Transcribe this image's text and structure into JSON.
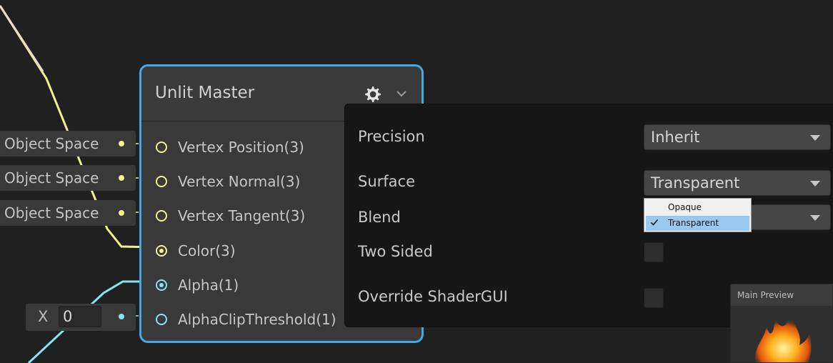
{
  "inputs": {
    "vertex_position_space": "Object Space",
    "vertex_normal_space": "Object Space",
    "vertex_tangent_space": "Object Space",
    "alpha_clip": {
      "axis_label": "X",
      "value": "0"
    }
  },
  "node": {
    "title": "Unlit Master",
    "gear_icon": "gear-icon",
    "collapse_icon": "chevron-down-icon",
    "ports": [
      {
        "label": "Vertex Position(3)",
        "color": "#f4f58e",
        "connected": false
      },
      {
        "label": "Vertex Normal(3)",
        "color": "#f4f58e",
        "connected": false
      },
      {
        "label": "Vertex Tangent(3)",
        "color": "#f4f58e",
        "connected": false
      },
      {
        "label": "Color(3)",
        "color": "#f4f58e",
        "connected": true
      },
      {
        "label": "Alpha(1)",
        "color": "#84e4f0",
        "connected": true
      },
      {
        "label": "AlphaClipThreshold(1)",
        "color": "#84e4f0",
        "connected": false
      }
    ],
    "accent_color": "#44a8e4"
  },
  "settings": {
    "precision": {
      "label": "Precision",
      "value": "Inherit"
    },
    "surface": {
      "label": "Surface",
      "value": "Transparent"
    },
    "blend": {
      "label": "Blend",
      "value": ""
    },
    "two_sided": {
      "label": "Two Sided",
      "checked": false
    },
    "override_shader_gui": {
      "label": "Override ShaderGUI",
      "checked": false
    }
  },
  "surface_menu": {
    "options": [
      "Opaque",
      "Transparent"
    ],
    "selected": "Transparent",
    "check_icon": "check-icon"
  },
  "preview": {
    "title": "Main Preview"
  }
}
